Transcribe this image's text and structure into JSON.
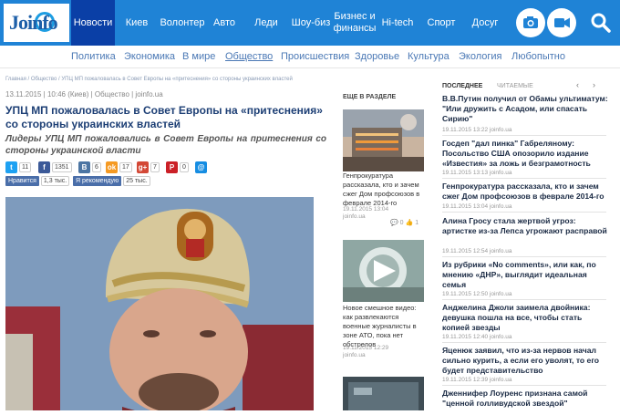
{
  "logo": {
    "text": "Joinfo"
  },
  "nav": {
    "items": [
      {
        "label": "Новости"
      },
      {
        "label": "Киев"
      },
      {
        "label": "Волонтер"
      },
      {
        "label": "Авто"
      },
      {
        "label": "Леди"
      },
      {
        "label": "Шоу-биз"
      },
      {
        "label": "Бизнес и финансы"
      },
      {
        "label": "Hi-tech"
      },
      {
        "label": "Спорт"
      },
      {
        "label": "Досуг"
      }
    ],
    "icons": [
      "camera-icon",
      "video-icon",
      "search-icon"
    ]
  },
  "subnav": {
    "items": [
      {
        "label": "Политика"
      },
      {
        "label": "Экономика"
      },
      {
        "label": "В мире"
      },
      {
        "label": "Общество"
      },
      {
        "label": "Происшествия"
      },
      {
        "label": "Здоровье"
      },
      {
        "label": "Культура"
      },
      {
        "label": "Экология"
      },
      {
        "label": "Любопытно"
      }
    ]
  },
  "article": {
    "breadcrumb": "Главная  /  Общество  /  УПЦ МП пожаловалась в Совет Европы на «притеснения» со стороны украинских властей",
    "meta": "13.11.2015 | 10:46 (Киев) | Общество | joinfo.ua",
    "title": "УПЦ МП пожаловалась в Совет Европы на «притеснения» со стороны украинских властей",
    "lead": "Лидеры УПЦ МП пожаловались в Совет Европы на притеснения со стороны украинской власти",
    "share": [
      {
        "icon": "twitter-icon",
        "color": "#1da1f2",
        "glyph": "t",
        "count": "11"
      },
      {
        "icon": "facebook-icon",
        "color": "#3b5998",
        "glyph": "f",
        "count": "1351"
      },
      {
        "icon": "vk-icon",
        "color": "#4c75a3",
        "glyph": "B",
        "count": "6"
      },
      {
        "icon": "odnoklassniki-icon",
        "color": "#f59a23",
        "glyph": "ok",
        "count": "17"
      },
      {
        "icon": "googleplus-icon",
        "color": "#d34836",
        "glyph": "g+",
        "count": "7"
      },
      {
        "icon": "pinterest-icon",
        "color": "#cb2027",
        "glyph": "P",
        "count": "0"
      },
      {
        "icon": "myworld-icon",
        "color": "#168de2",
        "glyph": "@",
        "count": ""
      }
    ],
    "like_fb": {
      "label": "Нравится",
      "count": "1,3 тыс."
    },
    "like_vk": {
      "label": "Я рекомендую",
      "count": "25 тыс."
    }
  },
  "section": {
    "heading": "ЕЩЕ В РАЗДЕЛЕ",
    "items": [
      {
        "text": "Генпрокуратура рассказала, кто и зачем сжег Дом профсоюзов в феврале 2014-го",
        "date": "19.11.2015 13:04",
        "source": "joinfo.ua",
        "comments": "0",
        "likes": "1"
      },
      {
        "text": "Новое смешное видео: как развлекаются военные журналисты в зоне АТО, пока нет обстрелов",
        "date": "19.11.2015 12:29",
        "source": "joinfo.ua"
      }
    ]
  },
  "right": {
    "tab_active": "ПОСЛЕДНЕЕ",
    "tab_other": "ЧИТАЕМЫЕ",
    "prev": "‹",
    "next": "›",
    "items": [
      {
        "title": "В.В.Путин получил от Обамы ультиматум: \"Или дружить с Асадом, или спасать Сирию\"",
        "date": "19.11.2015 13:22 joinfo.ua"
      },
      {
        "title": "Госдеп \"дал пинка\" Габреляному: Посольство США опозорило издание «Известия» за ложь и безграмотность",
        "date": "19.11.2015 13:13 joinfo.ua"
      },
      {
        "title": "Генпрокуратура рассказала, кто и зачем сжег Дом профсоюзов в феврале 2014-го",
        "date": "19.11.2015 13:04 joinfo.ua"
      },
      {
        "title": "Алина Гросу стала жертвой угроз: артистке из-за Лепса угрожают расправой",
        "date": "19.11.2015 12:54 joinfo.ua"
      },
      {
        "title": "Из рубрики «No comments», или как, по мнению «ДНР», выглядит идеальная семья",
        "date": "19.11.2015 12:50 joinfo.ua"
      },
      {
        "title": "Анджелина Джоли заимела двойника: девушка пошла на все, чтобы стать копией звезды",
        "date": "19.11.2015 12:40 joinfo.ua"
      },
      {
        "title": "Яценюк заявил, что из-за нервов начал сильно курить, а если его уволят, то его будет представительство",
        "date": "19.11.2015 12:39 joinfo.ua"
      },
      {
        "title": "Дженнифер Лоуренс признана самой \"ценной голливудской звездой\"",
        "date": ""
      }
    ]
  }
}
